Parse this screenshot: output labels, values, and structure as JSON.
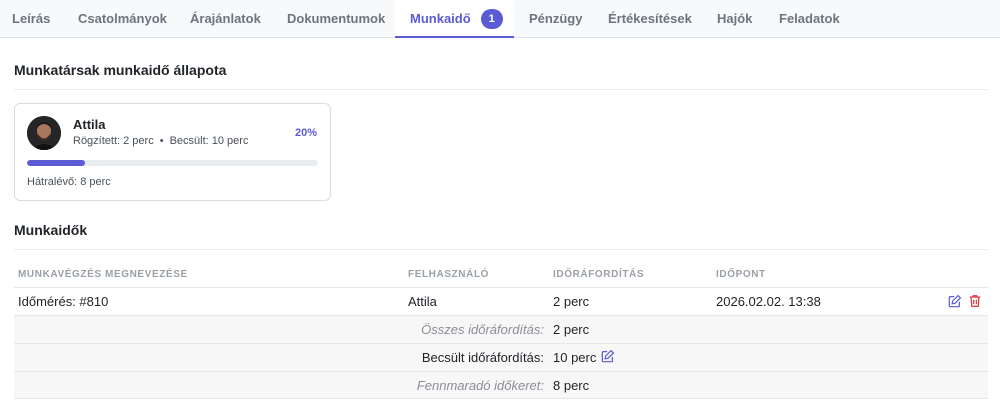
{
  "tabs": [
    {
      "label": "Leírás"
    },
    {
      "label": "Csatolmányok"
    },
    {
      "label": "Árajánlatok"
    },
    {
      "label": "Dokumentumok"
    },
    {
      "label": "Munkaidő",
      "badge": "1",
      "active": true
    },
    {
      "label": "Pénzügy"
    },
    {
      "label": "Értékesítések"
    },
    {
      "label": "Hajók"
    },
    {
      "label": "Feladatok"
    }
  ],
  "status_section": {
    "title": "Munkatársak munkaidő állapota",
    "card": {
      "name": "Attila",
      "recorded": "Rögzített: 2 perc",
      "separator": "•",
      "estimated": "Becsült: 10 perc",
      "percent_label": "20%",
      "progress_fraction": 0.2,
      "remaining": "Hátralévő: 8 perc"
    }
  },
  "worktimes_section": {
    "title": "Munkaidők",
    "columns": [
      "Munkavégzés megnevezése",
      "Felhasználó",
      "Időráfordítás",
      "Időpont"
    ],
    "rows": [
      {
        "name": "Időmérés: #810",
        "user": "Attila",
        "duration": "2 perc",
        "time": "2026.02.02. 13:38"
      }
    ],
    "summary": {
      "total_label": "Összes időráfordítás:",
      "total_value": "2 perc",
      "estimated_label": "Becsült időráfordítás:",
      "estimated_value": "10 perc",
      "remaining_label": "Fennmaradó időkeret:",
      "remaining_value": "8 perc"
    }
  },
  "icons": {
    "edit": "pencil-square-icon",
    "delete": "trash-icon"
  },
  "colors": {
    "accent": "#5b5bd6",
    "danger": "#dc3545"
  }
}
